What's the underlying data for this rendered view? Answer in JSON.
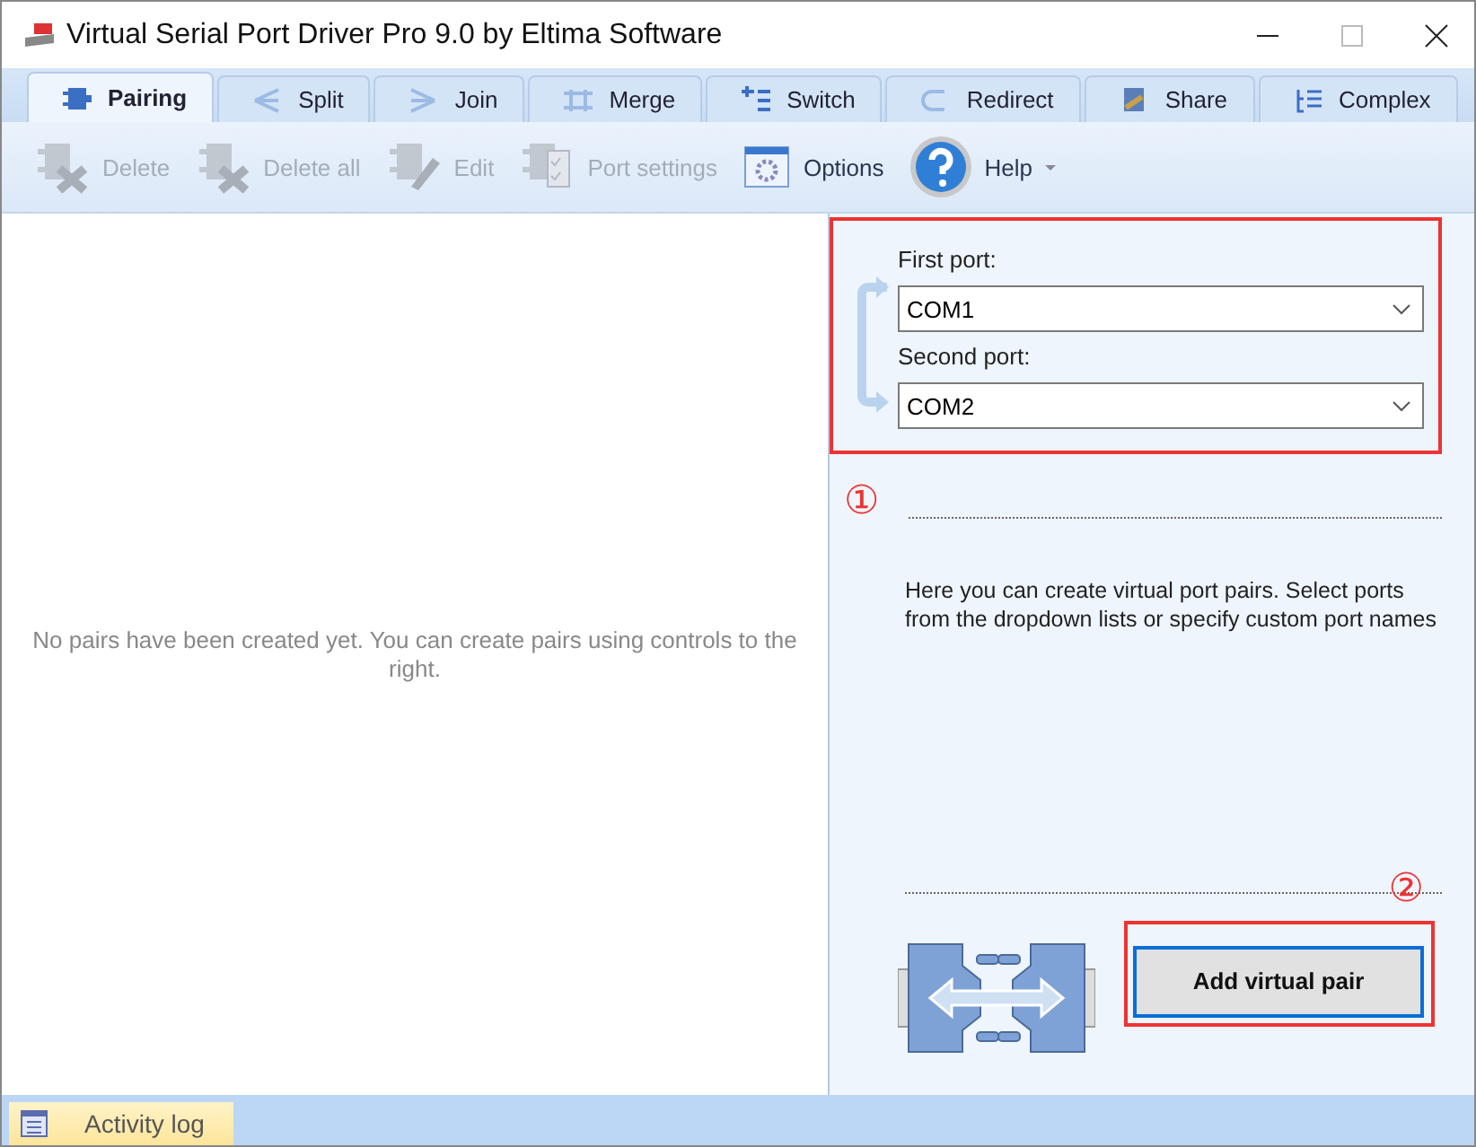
{
  "window": {
    "title": "Virtual Serial Port Driver Pro 9.0 by Eltima Software"
  },
  "tabs": [
    {
      "label": "Pairing",
      "selected": true
    },
    {
      "label": "Split",
      "selected": false
    },
    {
      "label": "Join",
      "selected": false
    },
    {
      "label": "Merge",
      "selected": false
    },
    {
      "label": "Switch",
      "selected": false
    },
    {
      "label": "Redirect",
      "selected": false
    },
    {
      "label": "Share",
      "selected": false
    },
    {
      "label": "Complex",
      "selected": false
    }
  ],
  "toolbar": [
    {
      "label": "Delete",
      "disabled": true
    },
    {
      "label": "Delete all",
      "disabled": true
    },
    {
      "label": "Edit",
      "disabled": true
    },
    {
      "label": "Port settings",
      "disabled": true
    },
    {
      "label": "Options",
      "disabled": false
    },
    {
      "label": "Help",
      "disabled": false,
      "dropdown": true
    }
  ],
  "pairs_panel": {
    "empty_message": "No pairs have been created yet. You can create pairs using controls to the right."
  },
  "pair_form": {
    "first_port": {
      "label": "First port:",
      "value": "COM1"
    },
    "second_port": {
      "label": "Second port:",
      "value": "COM2"
    },
    "description": "Here you can create virtual port pairs. Select ports from the dropdown lists or specify custom port names",
    "add_button": "Add virtual pair"
  },
  "annotations": [
    "①",
    "②"
  ],
  "status_bar": {
    "tab": "Activity log"
  }
}
